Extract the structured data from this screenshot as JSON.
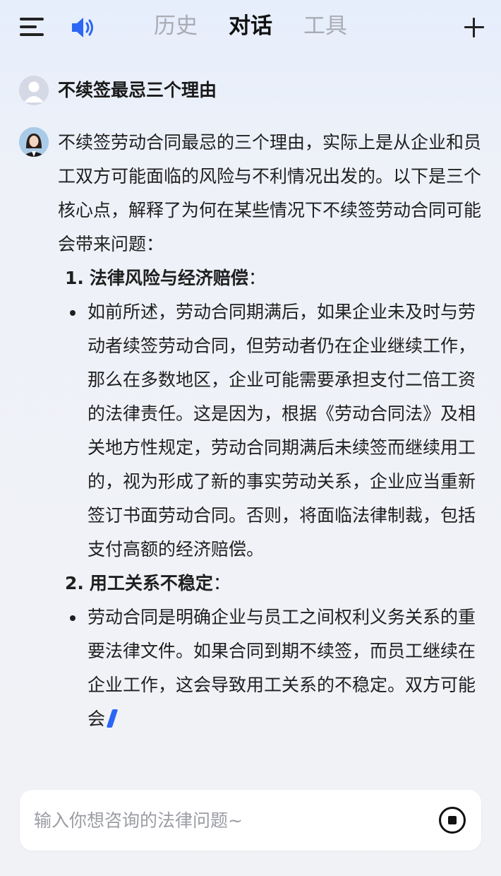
{
  "header": {
    "menu_icon": "menu-icon",
    "speaker_icon": "speaker-icon",
    "tabs": [
      {
        "label": "历史",
        "active": false
      },
      {
        "label": "对话",
        "active": true
      },
      {
        "label": "工具",
        "active": false
      }
    ],
    "plus_icon": "plus-icon"
  },
  "conversation": {
    "user_message": "不续签最忌三个理由",
    "bot_intro": "不续签劳动合同最忌的三个理由，实际上是从企业和员工双方可能面临的风险与不利情况出发的。以下是三个核心点，解释了为何在某些情况下不续签劳动合同可能会带来问题：",
    "points": [
      {
        "number": "1.",
        "title": "法律风险与经济赔偿",
        "suffix": "：",
        "bullet": "如前所述，劳动合同期满后，如果企业未及时与劳动者续签劳动合同，但劳动者仍在企业继续工作，那么在多数地区，企业可能需要承担支付二倍工资的法律责任。这是因为，根据《劳动合同法》及相关地方性规定，劳动合同期满后未续签而继续用工的，视为形成了新的事实劳动关系，企业应当重新签订书面劳动合同。否则，将面临法律制裁，包括支付高额的经济赔偿。"
      },
      {
        "number": "2.",
        "title": "用工关系不稳定",
        "suffix": "：",
        "bullet": "劳动合同是明确企业与员工之间权利义务关系的重要法律文件。如果合同到期不续签，而员工继续在企业工作，这会导致用工关系的不稳定。双方可能会"
      }
    ]
  },
  "input": {
    "placeholder": "输入你想咨询的法律问题~",
    "value": ""
  },
  "colors": {
    "accent": "#2b66f5",
    "inactive_tab": "#a9acb4",
    "text": "#1f1f1f"
  }
}
